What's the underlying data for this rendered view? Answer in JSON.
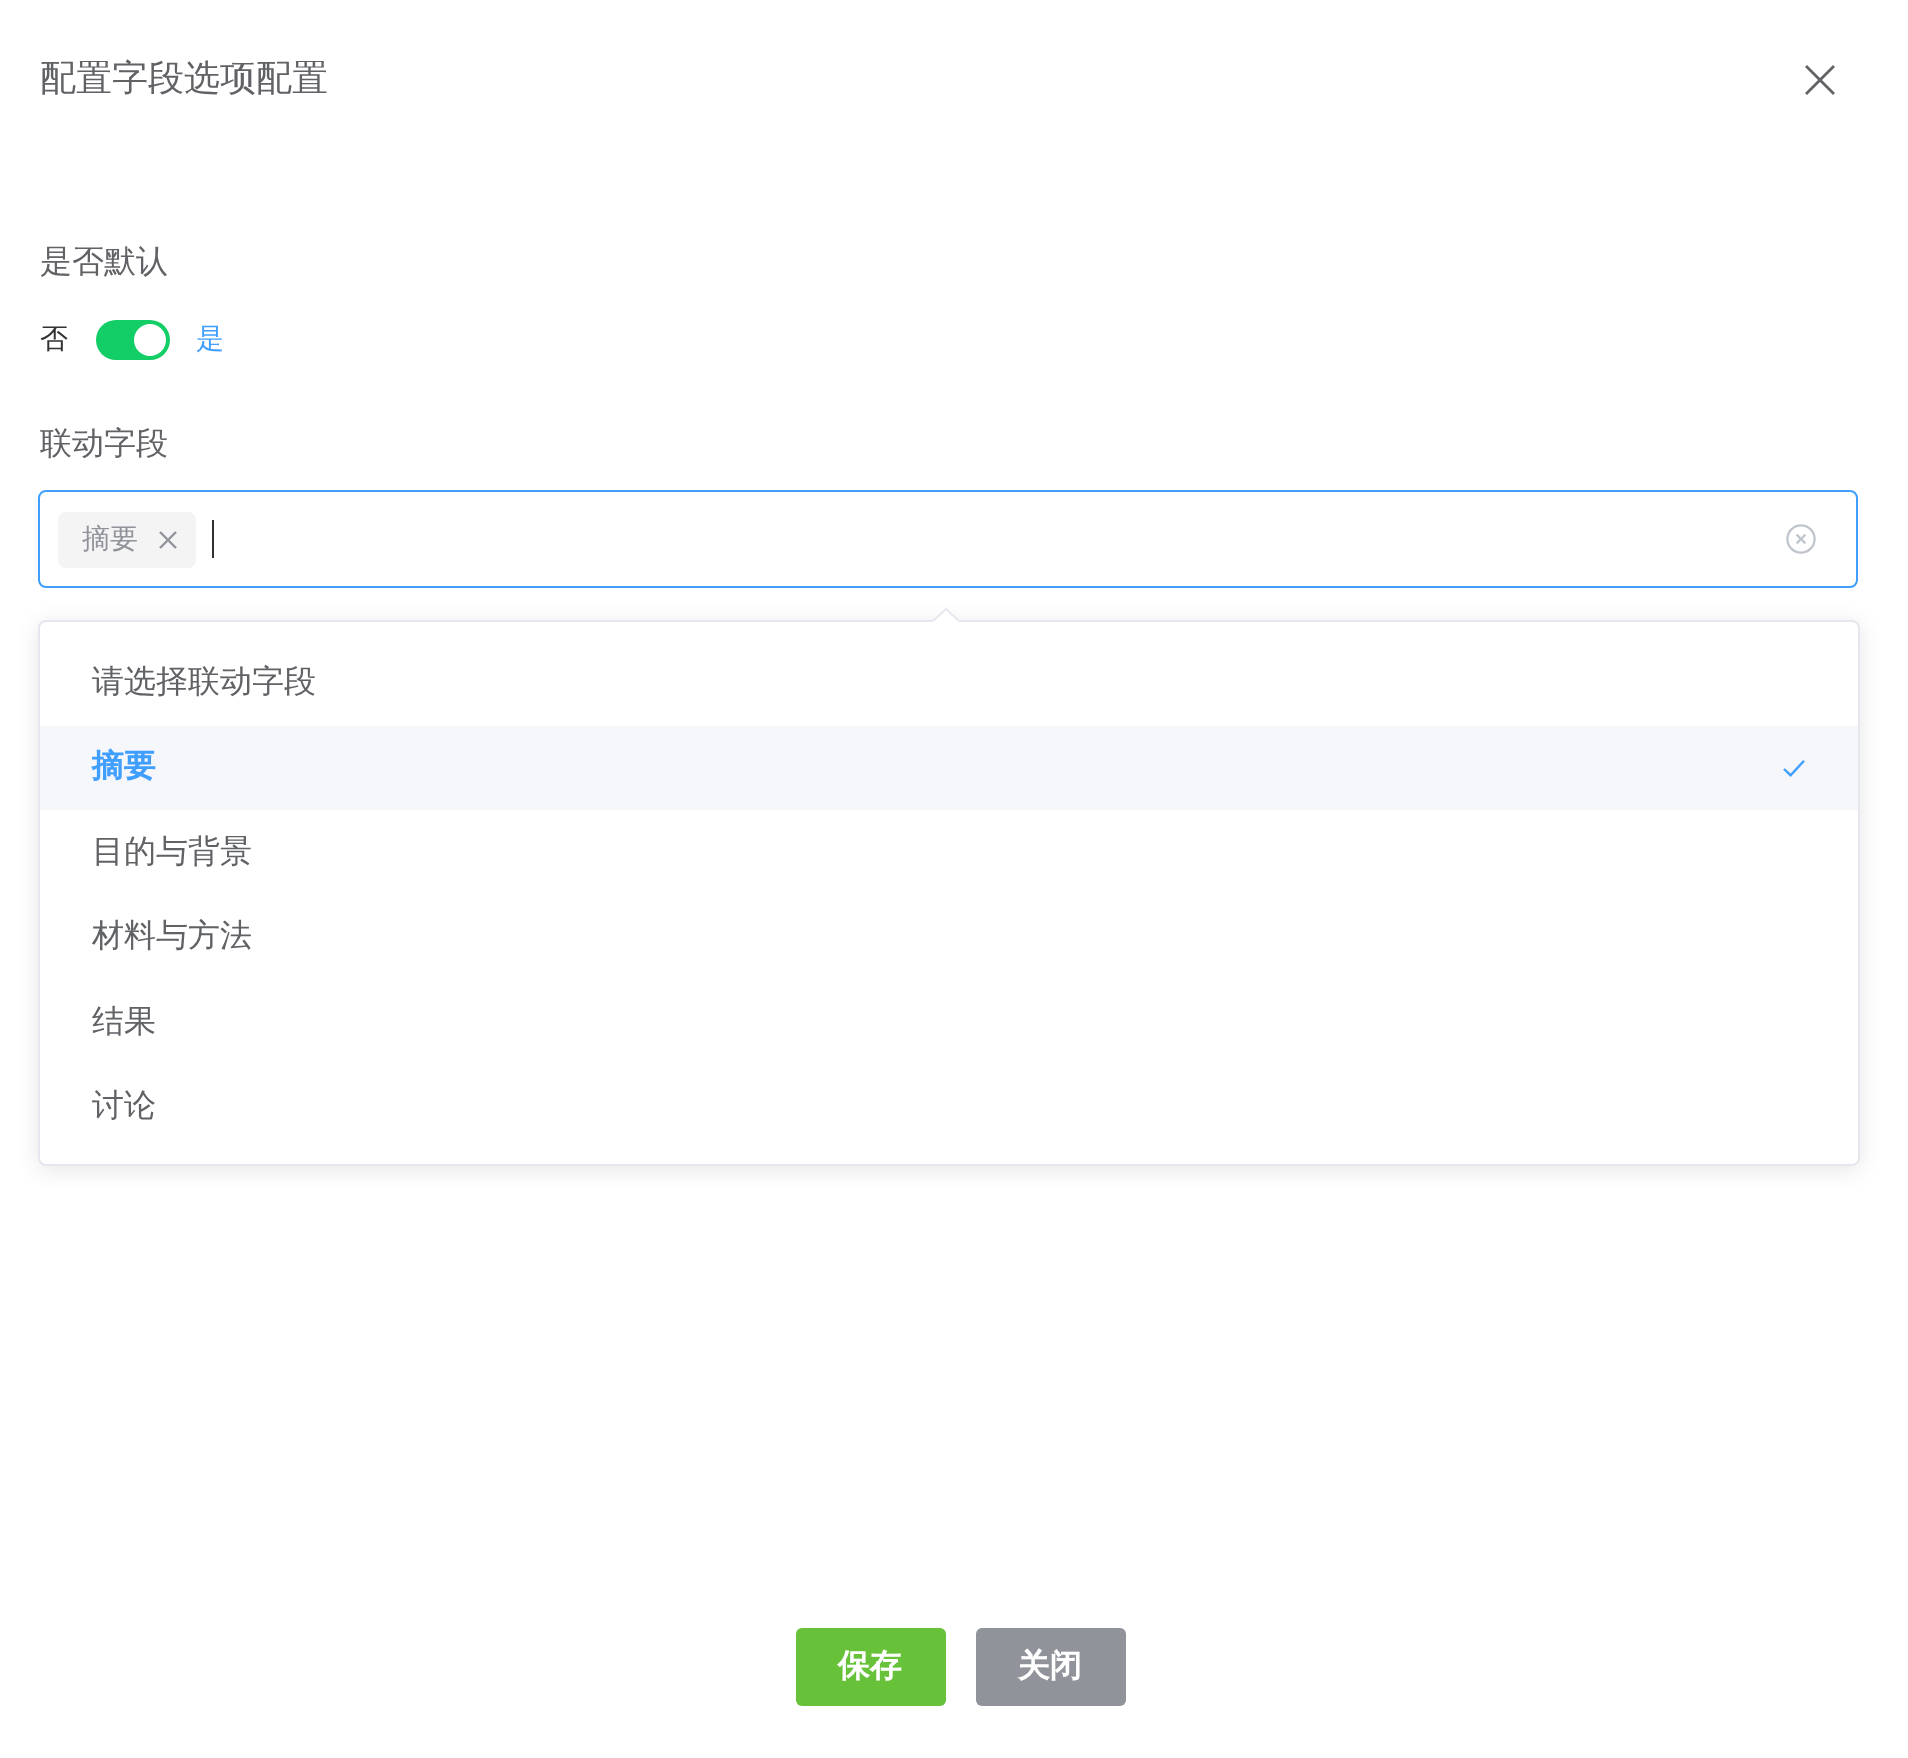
{
  "dialog": {
    "title": "配置字段选项配置"
  },
  "default_field": {
    "label": "是否默认",
    "inactive_text": "否",
    "active_text": "是",
    "on": true
  },
  "linked_field": {
    "label": "联动字段",
    "focused": true,
    "tags": [
      {
        "label": "摘要"
      }
    ],
    "options": [
      {
        "label": "请选择联动字段",
        "selected": false
      },
      {
        "label": "摘要",
        "selected": true
      },
      {
        "label": "目的与背景",
        "selected": false
      },
      {
        "label": "材料与方法",
        "selected": false
      },
      {
        "label": "结果",
        "selected": false
      },
      {
        "label": "讨论",
        "selected": false
      }
    ]
  },
  "buttons": [
    {
      "label": "保存",
      "kind": "success"
    },
    {
      "label": "关闭",
      "kind": "info"
    }
  ]
}
